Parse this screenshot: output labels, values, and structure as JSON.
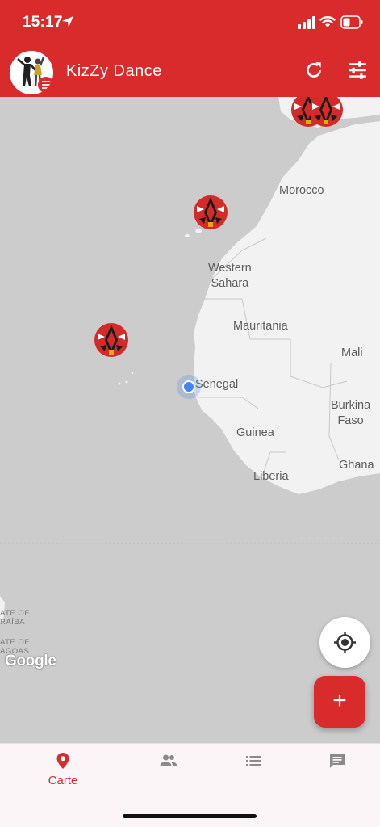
{
  "status_bar": {
    "time": "15:17",
    "icons": [
      "location-arrow-icon",
      "signal-icon",
      "wifi-icon",
      "battery-icon"
    ]
  },
  "app_bar": {
    "title": "KizZy Dance",
    "logo": "dancers-logo",
    "actions": [
      "refresh-icon",
      "tune-icon"
    ],
    "color": "#d92b2b"
  },
  "map": {
    "labels": {
      "morocco": "Morocco",
      "western_sahara": "Western\nSahara",
      "mauritania": "Mauritania",
      "mali": "Mali",
      "senegal": "Senegal",
      "burkina_faso": "Burkina\nFaso",
      "guinea": "Guinea",
      "ghana": "Ghana",
      "liberia": "Liberia"
    },
    "edge_labels": {
      "paraiba": "ATE OF\nRAÍBA",
      "alagoas": "ATE OF\nAGOAS"
    },
    "attribution": "Google",
    "marker_icon": "mask-marker-icon",
    "land_color": "#f2f2f2",
    "water_color": "#cccccc"
  },
  "fabs": {
    "locate_icon": "my-location-icon",
    "add_label": "+"
  },
  "bottom_nav": {
    "items": [
      {
        "label": "Carte",
        "icon": "map-pin-icon",
        "active": true
      },
      {
        "label": "",
        "icon": "people-icon",
        "active": false
      },
      {
        "label": "",
        "icon": "list-icon",
        "active": false
      },
      {
        "label": "",
        "icon": "chat-icon",
        "active": false
      }
    ],
    "active_color": "#d92b2b",
    "inactive_color": "#8a8a8a"
  }
}
